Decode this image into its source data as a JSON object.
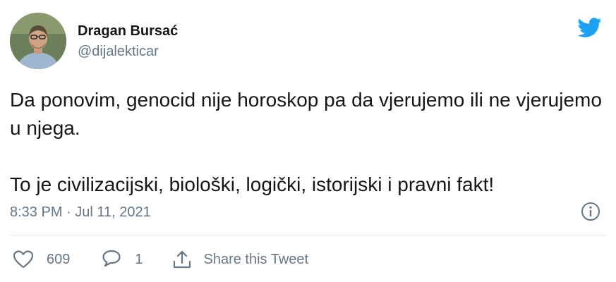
{
  "author": {
    "name": "Dragan Bursać",
    "handle": "@dijalekticar"
  },
  "tweet": {
    "paragraphs": [
      "Da ponovim, genocid nije horoskop pa da vjerujemo ili ne vjerujemo u njega.",
      "To je civilizacijski, biološki, logički, istorijski i pravni fakt!"
    ],
    "timestamp": "8:33 PM · Jul 11, 2021"
  },
  "actions": {
    "like_count": "609",
    "reply_count": "1",
    "share_label": "Share this Tweet"
  },
  "icons": {
    "brand": "twitter-bird-icon",
    "info": "info-icon",
    "like": "heart-icon",
    "reply": "reply-bubble-icon",
    "share": "share-icon"
  },
  "colors": {
    "brand": "#1da1f2",
    "text": "#14171a",
    "secondary_text": "#657786",
    "divider": "#e1e8ed"
  }
}
